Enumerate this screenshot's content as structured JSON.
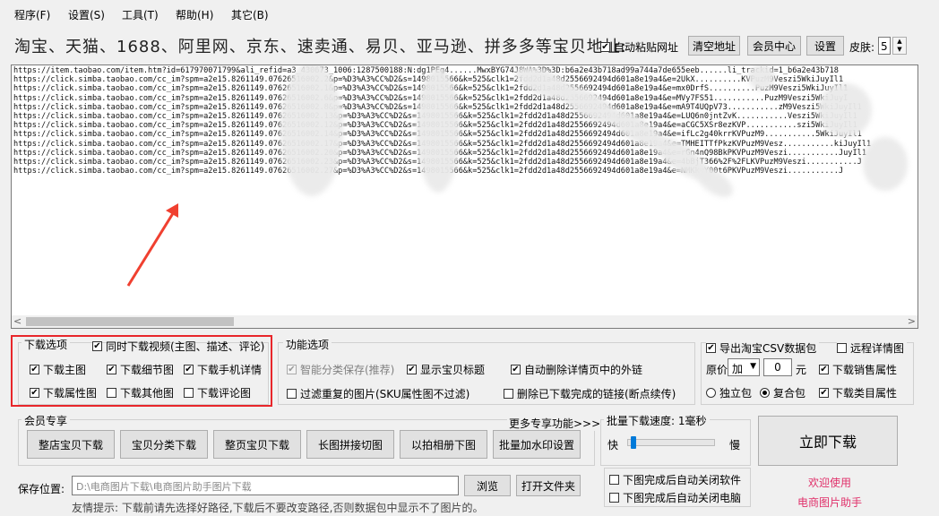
{
  "menu": [
    {
      "label": "程序(F)"
    },
    {
      "label": "设置(S)"
    },
    {
      "label": "工具(T)"
    },
    {
      "label": "帮助(H)"
    },
    {
      "label": "其它(B)"
    }
  ],
  "header": {
    "sites_label": "淘宝、天猫、1688、阿里网、京东、速卖通、易贝、亚马逊、拼多多等宝贝地址:",
    "auto_paste_label": "自动粘贴网址",
    "auto_paste_checked": true,
    "clear_btn": "清空地址",
    "member_btn": "会员中心",
    "settings_btn": "设置",
    "skin_label": "皮肤:",
    "skin_value": "5"
  },
  "urls": [
    "https://item.taobao.com/item.htm?id=617970071799&ali_refid=a3_430673_1006:1287500188:N:dg1PEg4......MwxBYG74J8WA%3D%3D:b6a2e43b718ad99a744a7de655eeb......li_trackid=1_b6a2e43b718",
    "https://click.simba.taobao.com/cc_im?spm=a2e15.8261149.07626516002.2&p=%D3%A3%CC%D2&s=1498015566&k=525&clk1=2fdd2d1a48d2556692494d601a8e19a4&e=2UkX..........KVPuzM9Veszi5WkiJuyIl1",
    "https://click.simba.taobao.com/cc_im?spm=a2e15.8261149.07626516002.1&p=%D3%A3%CC%D2&s=1498015566&k=525&clk1=2fdd2d1a48d2556692494d601a8e19a4&e=mx0DrfS..........PuzM9Veszi5WkiJuyIl1",
    "https://click.simba.taobao.com/cc_im?spm=a2e15.8261149.07626516002.6&p=%D3%A3%CC%D2&s=1498015566&k=525&clk1=2fdd2d1a48d2556692494d601a8e19a4&e=MVy7FS51...........PuzM9Veszi5WkiJuyI",
    "https://click.simba.taobao.com/cc_im?spm=a2e15.8261149.07626516002.8&p=%D3%A3%CC%D2&s=1498015566&k=525&clk1=2fdd2d1a48d2556692494d601a8e19a4&e=mA9T4UQpV73...........zM9Veszi5WkiJuyIl1",
    "https://click.simba.taobao.com/cc_im?spm=a2e15.8261149.07626516002.13&p=%D3%A3%CC%D2&s=1498015566&k=525&clk1=2fdd2d1a48d2556692494d601a8e19a4&e=LUQ6n0jntZvK...........Veszi5WkiJuyIl1",
    "https://click.simba.taobao.com/cc_im?spm=a2e15.8261149.07626516002.12&p=%D3%A3%CC%D2&s=1498015566&k=525&clk1=2fdd2d1a48d2556692494d601a8e19a4&e=aCGC5XSr8ezKVP...........szi5WkiJuyIl1",
    "https://click.simba.taobao.com/cc_im?spm=a2e15.8261149.07626516002.14&p=%D3%A3%CC%D2&s=1498015566&k=525&clk1=2fdd2d1a48d2556692494d601a8e19a4&e=ifLc2g40krrKVPuzM9...........5WkiJuyIl1",
    "https://click.simba.taobao.com/cc_im?spm=a2e15.8261149.07626516002.17&p=%D3%A3%CC%D2&s=1498015566&k=525&clk1=2fdd2d1a48d2556692494d601a8e19a4&e=TMHEITTfPkzKVPuzM9Vesz...........kiJuyIl1",
    "https://click.simba.taobao.com/cc_im?spm=a2e15.8261149.07626516002.20&p=%D3%A3%CC%D2&s=1498015566&k=525&clk1=2fdd2d1a48d2556692494d601a8e19a4&e=rGn4nQ98BkPKVPuzM9Veszi...........JuyIl1",
    "https://click.simba.taobao.com/cc_im?spm=a2e15.8261149.07626516002.23&p=%D3%A3%CC%D2&s=1498015566&k=525&clk1=2fdd2d1a48d2556692494d601a8e19a4&e=4bBjT366%2F%2FLKVPuzM9Veszi...........J",
    "https://click.simba.taobao.com/cc_im?spm=a2e15.8261149.07626516002.27&p=%D3%A3%CC%D2&s=1498015566&k=525&clk1=2fdd2d1a48d2556692494d601a8e19a4&e=NMKkvY00t6PKVPuzM9Veszi...........J"
  ],
  "download_options": {
    "title": "下载选项",
    "video_label": "同时下载视频(主图、描述、评论)",
    "items": [
      {
        "label": "下载主图",
        "checked": true
      },
      {
        "label": "下载细节图",
        "checked": true
      },
      {
        "label": "下载手机详情",
        "checked": true
      },
      {
        "label": "下载属性图",
        "checked": true
      },
      {
        "label": "下载其他图",
        "checked": false
      },
      {
        "label": "下载评论图",
        "checked": false
      }
    ]
  },
  "function_options": {
    "title": "功能选项",
    "smart_save": "智能分类保存(推荐)",
    "show_title": "显示宝贝标题",
    "auto_delete_links": "自动删除详情页中的外链",
    "filter_dup": "过滤重复的图片(SKU属性图不过滤)",
    "delete_done": "删除已下载完成的链接(断点续传)"
  },
  "csv_options": {
    "export_csv": "导出淘宝CSV数据包",
    "remote_detail": "远程详情图",
    "price_label": "原价",
    "price_op": "加",
    "price_value": "0",
    "price_unit": "元",
    "sales_attr": "下载销售属性",
    "standalone": "独立包",
    "combined": "复合包",
    "category_attr": "下载类目属性"
  },
  "member": {
    "title": "会员专享",
    "more_link": "更多专享功能>>>",
    "buttons": [
      "整店宝贝下载",
      "宝贝分类下载",
      "整页宝贝下载",
      "长图拼接切图",
      "以拍相册下图",
      "批量加水印设置"
    ]
  },
  "speed": {
    "label": "批量下载速度: 1毫秒",
    "fast": "快",
    "slow": "慢",
    "level": 0.03
  },
  "auto_close": {
    "close_app": "下图完成后自动关闭软件",
    "close_pc": "下图完成后自动关闭电脑"
  },
  "main_action": {
    "download_btn": "立即下载",
    "welcome": "欢迎使用",
    "app_name": "电商图片助手"
  },
  "save": {
    "label": "保存位置:",
    "path": "D:\\电商图片下载\\电商图片助手图片下载",
    "browse_btn": "浏览",
    "open_btn": "打开文件夹",
    "tip": "友情提示: 下载前请先选择好路径,下载后不要改变路径,否则数据包中显示不了图片的。"
  },
  "colors": {
    "highlight_red": "#e8262a",
    "arrow_red": "#f04030",
    "brand_pink": "#e0306a"
  }
}
